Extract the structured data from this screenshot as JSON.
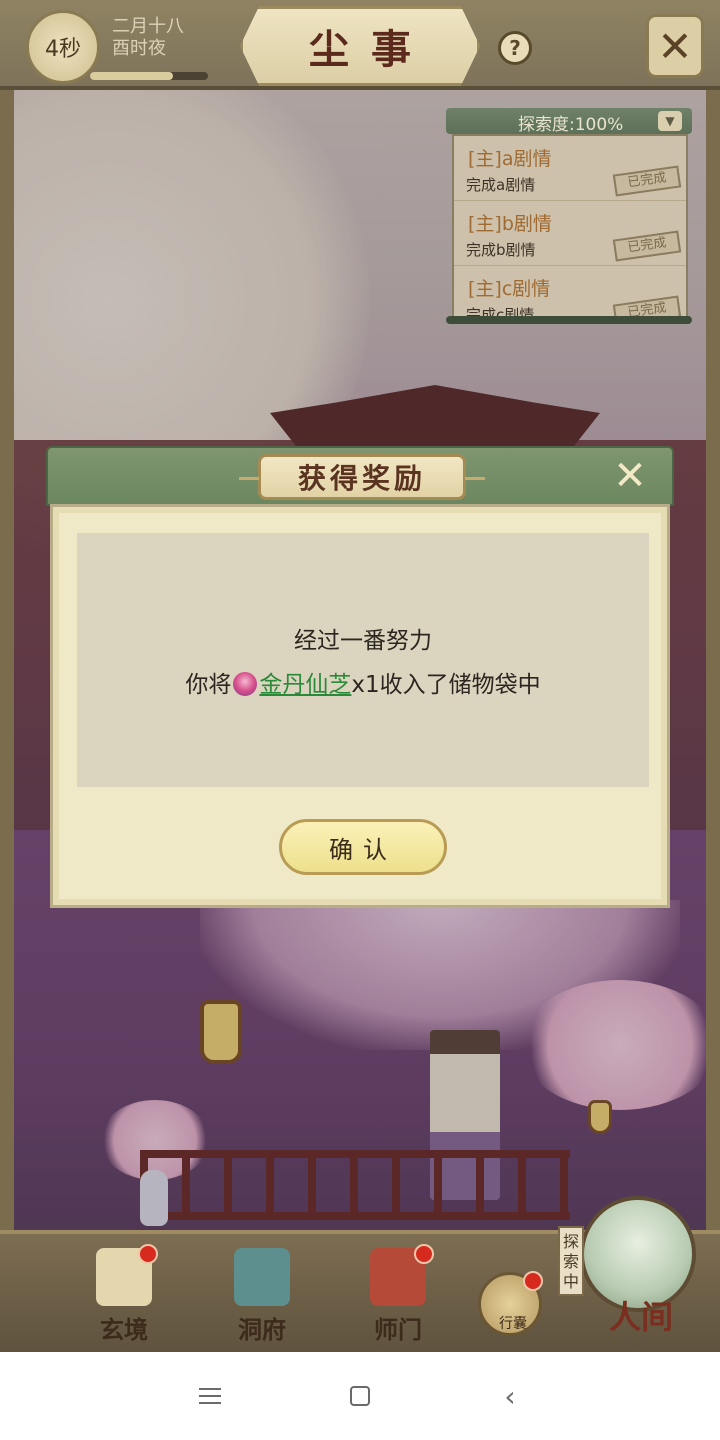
{
  "hud": {
    "countdown": "4秒",
    "date_line1": "二月十八",
    "date_line2": "酉时夜",
    "time_progress": 0.7,
    "title": "尘事",
    "help_icon": "?",
    "close_icon": "✕"
  },
  "quest_panel": {
    "header": "探索度:100%",
    "toggle_icon": "chevron-down-icon",
    "quests": [
      {
        "title": "[主]a剧情",
        "desc": "完成a剧情",
        "status": "已完成"
      },
      {
        "title": "[主]b剧情",
        "desc": "完成b剧情",
        "status": "已完成"
      },
      {
        "title": "[主]c剧情",
        "desc": "完成c剧情",
        "status": "已完成"
      }
    ]
  },
  "dialog": {
    "title": "获得奖励",
    "close_icon": "✕",
    "message_line1": "经过一番努力",
    "message_prefix": "你将",
    "item_name": "金丹仙芝",
    "item_qty": "x1",
    "message_suffix": "收入了储物袋中",
    "confirm_label": "确认"
  },
  "bottom_nav": {
    "items": [
      {
        "label": "玄境",
        "icon": "scroll-icon",
        "badge": true
      },
      {
        "label": "洞府",
        "icon": "lantern-house-icon",
        "badge": false
      },
      {
        "label": "师门",
        "icon": "banner-icon",
        "badge": true
      }
    ],
    "bag_label": "行囊",
    "explore_tag": "探索中",
    "world_label": "人间"
  },
  "colors": {
    "accent_green": "#6c8760",
    "item_link": "#2a8a3a",
    "badge_red": "#d62a1f"
  }
}
